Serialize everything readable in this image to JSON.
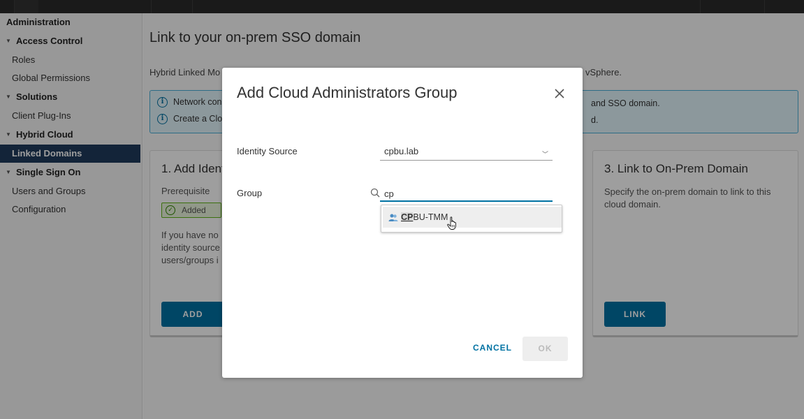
{
  "sidebar": {
    "title": "Administration",
    "groups": [
      {
        "label": "Access Control",
        "items": [
          "Roles",
          "Global Permissions"
        ]
      },
      {
        "label": "Solutions",
        "items": [
          "Client Plug-Ins"
        ]
      },
      {
        "label": "Hybrid Cloud",
        "items": [
          "Linked Domains"
        ]
      },
      {
        "label": "Single Sign On",
        "items": [
          "Users and Groups",
          "Configuration"
        ]
      }
    ],
    "active_item": "Linked Domains"
  },
  "main": {
    "title": "Link to your on-prem SSO domain",
    "description_start": "Hybrid Linked Mo",
    "description_end": "vSphere.",
    "info": [
      {
        "start": "Network con",
        "end": "and SSO domain."
      },
      {
        "start": "Create a Clo",
        "end": "d."
      }
    ],
    "card1": {
      "title": "1. Add Ident",
      "prerequisite": "Prerequisite",
      "badge": "Added",
      "text": [
        "If you have no",
        "identity source",
        "users/groups i"
      ],
      "button": "ADD"
    },
    "card3": {
      "title": "3. Link to On-Prem Domain",
      "description": "Specify the on-prem domain to link to this cloud domain.",
      "button": "LINK"
    }
  },
  "modal": {
    "title": "Add Cloud Administrators Group",
    "identity_source_label": "Identity Source",
    "identity_source_value": "cpbu.lab",
    "group_label": "Group",
    "group_query": "cp",
    "suggestion_match": "CP",
    "suggestion_rest": "BU-TMM",
    "cancel_label": "CANCEL",
    "ok_label": "OK"
  },
  "colors": {
    "accent": "#0072a3",
    "active_nav": "#1f3b5c",
    "info_bg": "#e3f5fc",
    "success": "#318700"
  }
}
